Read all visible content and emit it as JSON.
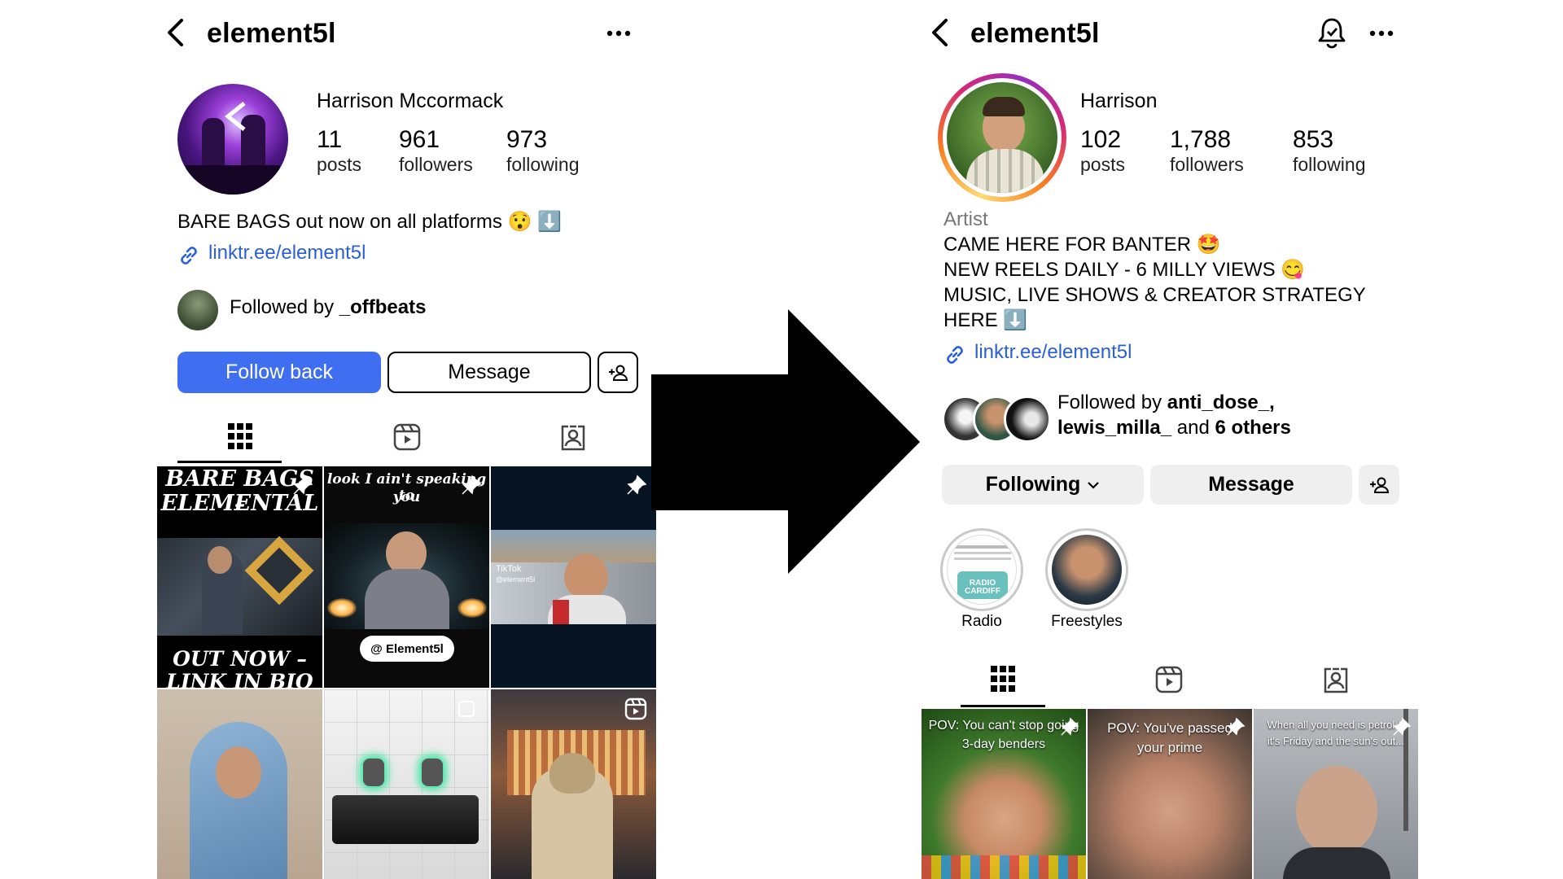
{
  "left": {
    "header": {
      "username": "element5l"
    },
    "profile": {
      "name": "Harrison Mccormack",
      "stats": [
        {
          "value": "11",
          "label": "posts"
        },
        {
          "value": "961",
          "label": "followers"
        },
        {
          "value": "973",
          "label": "following"
        }
      ],
      "bio_line": "BARE BAGS out now on all platforms 😯 ⬇️",
      "link": "linktr.ee/element5l",
      "followed_by_prefix": "Followed by ",
      "followed_by_user": "_offbeats"
    },
    "buttons": {
      "follow": "Follow back",
      "message": "Message"
    },
    "grid": [
      {
        "top_text": "BARE BAGS –",
        "top_text2": "ELEMENTAL",
        "bottom_text": "OUT NOW –",
        "bottom_text2": "LINK IN BIO"
      },
      {
        "caption": "look I ain't speaking to",
        "caption2": "you",
        "badge": "@ Element5l"
      },
      {
        "badge": "TikTok",
        "badge2": "@element5l"
      }
    ]
  },
  "right": {
    "header": {
      "username": "element5l"
    },
    "profile": {
      "name": "Harrison",
      "stats": [
        {
          "value": "102",
          "label": "posts"
        },
        {
          "value": "1,788",
          "label": "followers"
        },
        {
          "value": "853",
          "label": "following"
        }
      ],
      "category": "Artist",
      "bio_lines": [
        "CAME HERE FOR BANTER 🤩",
        "NEW REELS DAILY - 6 MILLY VIEWS 😋",
        "MUSIC, LIVE SHOWS & CREATOR STRATEGY",
        "HERE ⬇️"
      ],
      "link": "linktr.ee/element5l",
      "followed_by_prefix": "Followed by ",
      "followed_by_user1": "anti_dose_,",
      "followed_by_user2": "lewis_milla_",
      "followed_by_and": " and ",
      "followed_by_others": "6 others"
    },
    "buttons": {
      "following": "Following",
      "message": "Message"
    },
    "highlights": [
      {
        "label": "Radio",
        "inner_text": "RADIO CARDIFF"
      },
      {
        "label": "Freestyles"
      }
    ],
    "grid": [
      {
        "caption": "POV: You can't stop going",
        "caption2": "3-day benders"
      },
      {
        "caption": "POV: You've passed",
        "caption2": "your prime"
      },
      {
        "caption": "When all you need is petrol &",
        "caption2": "it's Friday and the sun's out..."
      }
    ]
  },
  "colors": {
    "primary_blue": "#3f6ff0",
    "link_blue": "#2a5fd8",
    "button_gray": "#efefef",
    "arrow": "#000000"
  }
}
